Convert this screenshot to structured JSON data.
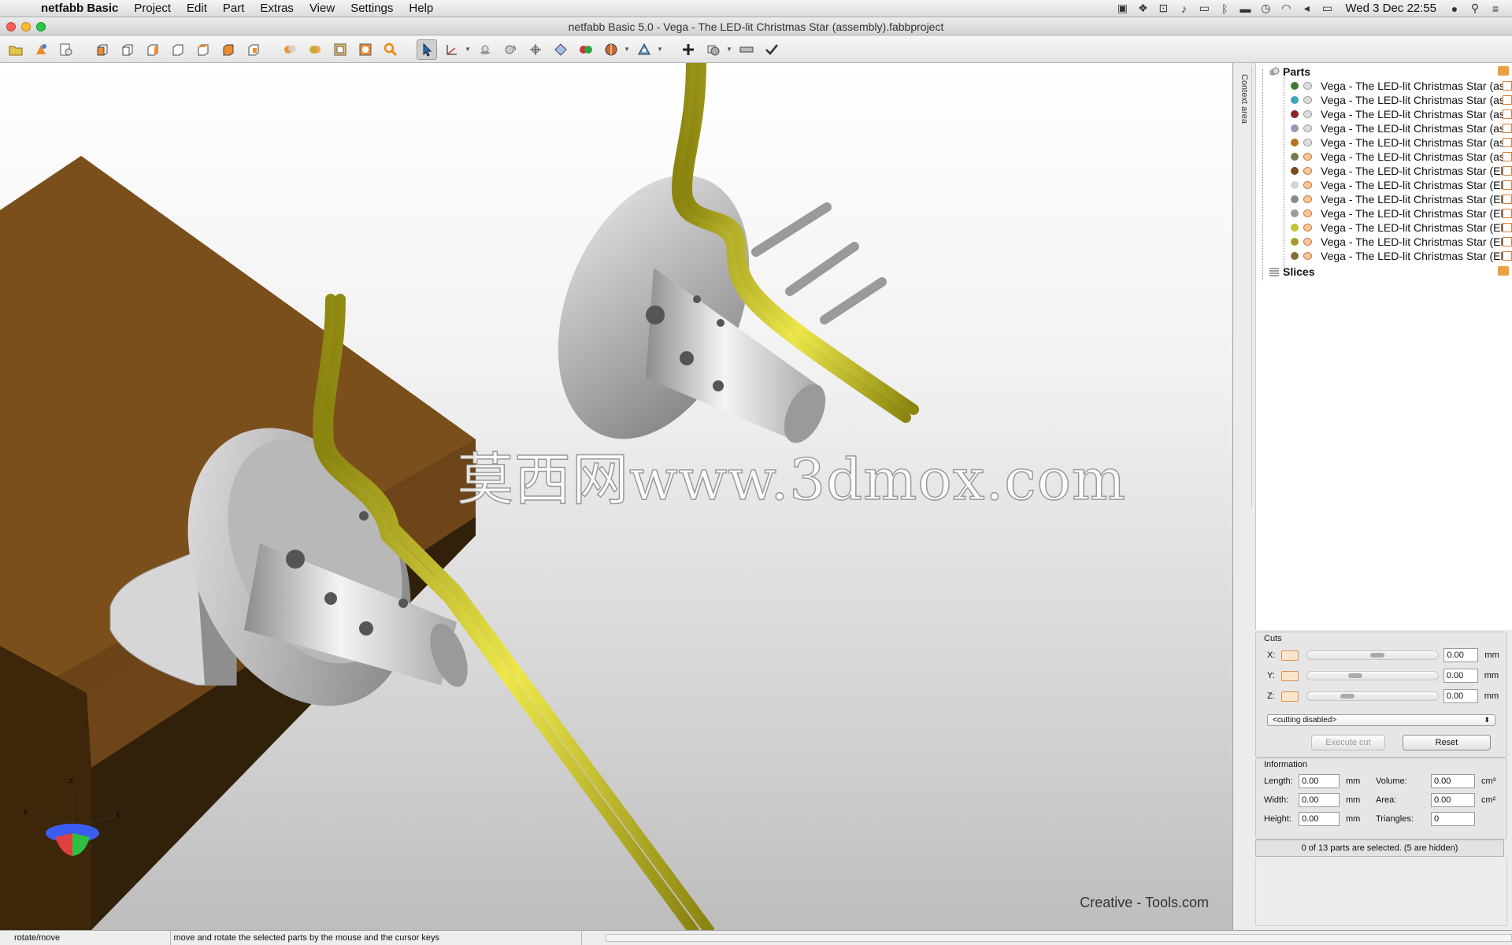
{
  "menubar": {
    "app_name": "netfabb Basic",
    "items": [
      "Project",
      "Edit",
      "Part",
      "Extras",
      "View",
      "Settings",
      "Help"
    ],
    "clock": "Wed 3 Dec  22:55"
  },
  "window": {
    "title": "netfabb Basic 5.0 - Vega - The LED-lit Christmas Star (assembly).fabbproject"
  },
  "viewport": {
    "watermark": "莫西网www.3dmox.com",
    "brand": "Creative - Tools.com",
    "axis_labels": {
      "x": "x",
      "y": "y",
      "z": "z"
    }
  },
  "panel": {
    "context_area_label": "Context area",
    "tree": {
      "parts_label": "Parts",
      "slices_label": "Slices",
      "items": [
        {
          "label": "Vega - The LED-lit Christmas Star (ass",
          "color": "#3b7d2e",
          "hidden": false
        },
        {
          "label": "Vega - The LED-lit Christmas Star (ass",
          "color": "#3aa6b8",
          "hidden": false
        },
        {
          "label": "Vega - The LED-lit Christmas Star (ass",
          "color": "#8a2323",
          "hidden": false
        },
        {
          "label": "Vega - The LED-lit Christmas Star (ass",
          "color": "#9e93b6",
          "hidden": false
        },
        {
          "label": "Vega - The LED-lit Christmas Star (ass",
          "color": "#b5731e",
          "hidden": false
        },
        {
          "label": "Vega - The LED-lit Christmas Star (ass",
          "color": "#7a7a52",
          "hidden": true
        },
        {
          "label": "Vega - The LED-lit Christmas Star (Elec",
          "color": "#7a4a1c",
          "hidden": true
        },
        {
          "label": "Vega - The LED-lit Christmas Star (Elec",
          "color": "#d4d4d4",
          "hidden": true
        },
        {
          "label": "Vega - The LED-lit Christmas Star (Elec",
          "color": "#8a8a8a",
          "hidden": true
        },
        {
          "label": "Vega - The LED-lit Christmas Star (Elec",
          "color": "#9a9a9a",
          "hidden": true
        },
        {
          "label": "Vega - The LED-lit Christmas Star (Elec",
          "color": "#c6c230",
          "hidden": true
        },
        {
          "label": "Vega - The LED-lit Christmas Star (Elec",
          "color": "#a89a28",
          "hidden": true
        },
        {
          "label": "Vega - The LED-lit Christmas Star (Elec",
          "color": "#8a6a3a",
          "hidden": true
        }
      ]
    },
    "cuts": {
      "title": "Cuts",
      "x_label": "X:",
      "y_label": "Y:",
      "z_label": "Z:",
      "x_value": "0.00",
      "y_value": "0.00",
      "z_value": "0.00",
      "unit": "mm",
      "mode": "<cutting disabled>",
      "execute_label": "Execute cut",
      "reset_label": "Reset"
    },
    "information": {
      "title": "Information",
      "length_label": "Length:",
      "length_value": "0.00",
      "width_label": "Width:",
      "width_value": "0.00",
      "height_label": "Height:",
      "height_value": "0.00",
      "length_unit": "mm",
      "volume_label": "Volume:",
      "volume_value": "0.00",
      "volume_unit": "cm³",
      "area_label": "Area:",
      "area_value": "0.00",
      "area_unit": "cm²",
      "triangles_label": "Triangles:",
      "triangles_value": "0"
    },
    "selection_status": "0 of 13 parts are selected. (5 are hidden)"
  },
  "statusbar": {
    "mode": "rotate/move",
    "message": "move and rotate the selected parts by the mouse and the cursor keys"
  },
  "colors": {
    "wood": "#7a4f1c",
    "wire": "#c8c21e",
    "part_white": "#d8d8d8"
  }
}
